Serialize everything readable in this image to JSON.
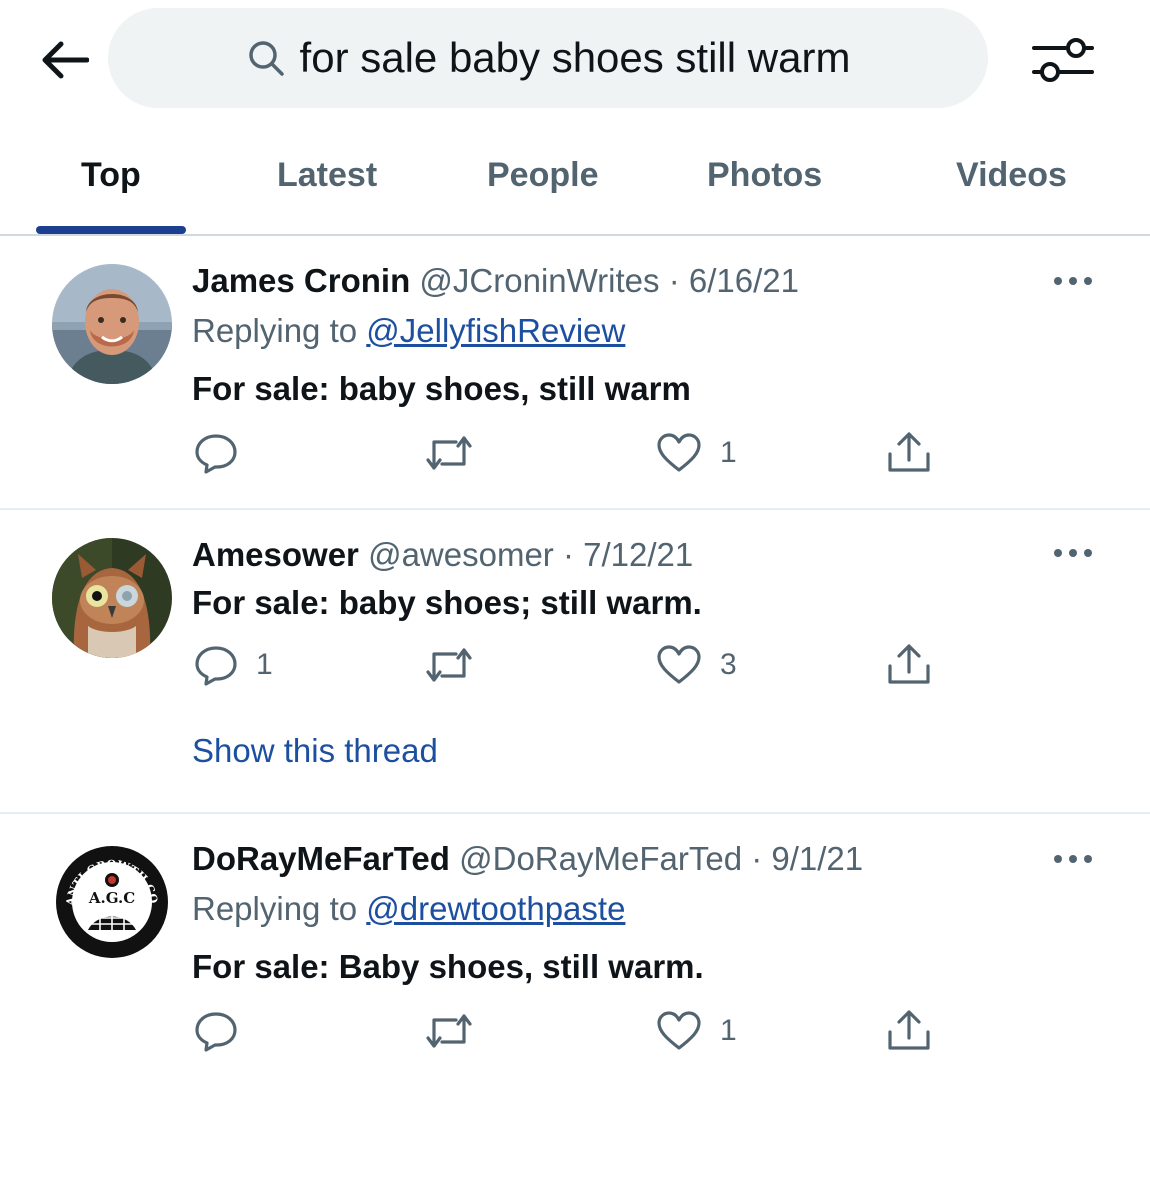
{
  "search": {
    "query": "for sale baby shoes still warm"
  },
  "tabs": [
    {
      "label": "Top",
      "active": true
    },
    {
      "label": "Latest",
      "active": false
    },
    {
      "label": "People",
      "active": false
    },
    {
      "label": "Photos",
      "active": false
    },
    {
      "label": "Videos",
      "active": false
    }
  ],
  "tweets": [
    {
      "name": "James Cronin",
      "handle": "@JCroninWrites",
      "date": "6/16/21",
      "reply_prefix": "Replying to ",
      "reply_to": "@JellyfishReview",
      "text": "For sale: baby shoes, still warm",
      "reply_count": "",
      "retweet_count": "",
      "like_count": "1"
    },
    {
      "name": "Amesower",
      "handle": "@awesomer",
      "date": "7/12/21",
      "text": "For sale: baby shoes; still warm.",
      "reply_count": "1",
      "retweet_count": "",
      "like_count": "3",
      "show_thread": "Show this thread"
    },
    {
      "name": "DoRayMeFarTed",
      "handle": "@DoRayMeFarTed",
      "date": "9/1/21",
      "reply_prefix": "Replying to ",
      "reply_to": "@drewtoothpaste",
      "text": "For sale: Baby shoes, still warm.",
      "reply_count": "",
      "retweet_count": "",
      "like_count": "1"
    }
  ],
  "avatar_logo_text": {
    "arc": "ANTI GROWTH COALITION",
    "center": "A.G.C"
  },
  "icons": {
    "back": "arrow-left-icon",
    "search": "search-icon",
    "filter": "sliders-icon",
    "more": "more-dots-icon",
    "reply": "reply-icon",
    "retweet": "retweet-icon",
    "like": "heart-icon",
    "share": "share-icon"
  },
  "colors": {
    "link": "#1d4fa0",
    "tab_indicator": "#1d3f8f",
    "muted": "#536471",
    "text": "#0f1419",
    "search_bg": "#eff3f4"
  }
}
